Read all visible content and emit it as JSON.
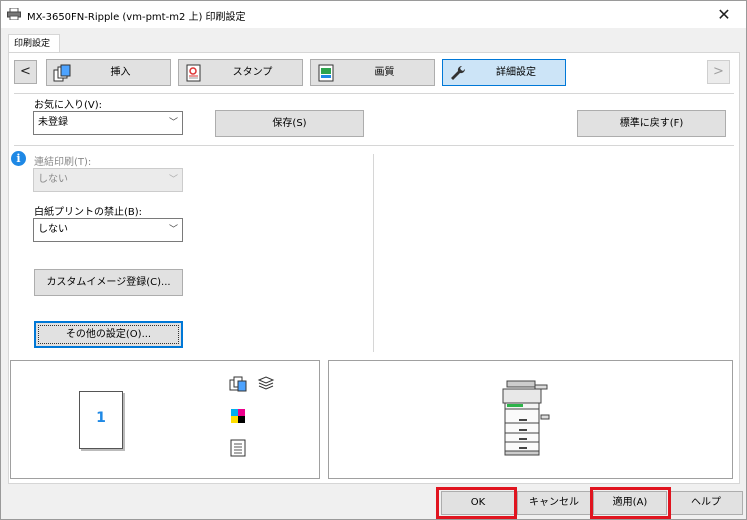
{
  "window": {
    "title": "MX-3650FN-Ripple (vm-pmt-m2 上) 印刷設定",
    "close_label": "✕"
  },
  "tab": {
    "label": "印刷設定"
  },
  "nav": {
    "prev_label": "<",
    "next_label": ">",
    "buttons": [
      {
        "label": "挿入",
        "icon": "insert-pages-icon"
      },
      {
        "label": "スタンプ",
        "icon": "stamp-icon"
      },
      {
        "label": "画質",
        "icon": "image-quality-icon"
      },
      {
        "label": "詳細設定",
        "icon": "wrench-icon",
        "selected": true
      }
    ]
  },
  "favorites": {
    "label": "お気に入り(V):",
    "value": "未登録",
    "save_label": "保存(S)",
    "reset_label": "標準に戻す(F)"
  },
  "linked_print": {
    "label": "連結印刷(T):",
    "value": "しない",
    "enabled": false
  },
  "blank_page": {
    "label": "白紙プリントの禁止(B):",
    "value": "しない"
  },
  "custom_image_label": "カスタムイメージ登録(C)...",
  "other_settings_label": "その他の設定(O)...",
  "preview": {
    "page_number": "1"
  },
  "footer": {
    "ok_label": "OK",
    "cancel_label": "キャンセル",
    "apply_label": "適用(A)",
    "help_label": "ヘルプ"
  },
  "colors": {
    "highlight": "#e0141f",
    "accent": "#0078d7",
    "info": "#1e88e5"
  }
}
